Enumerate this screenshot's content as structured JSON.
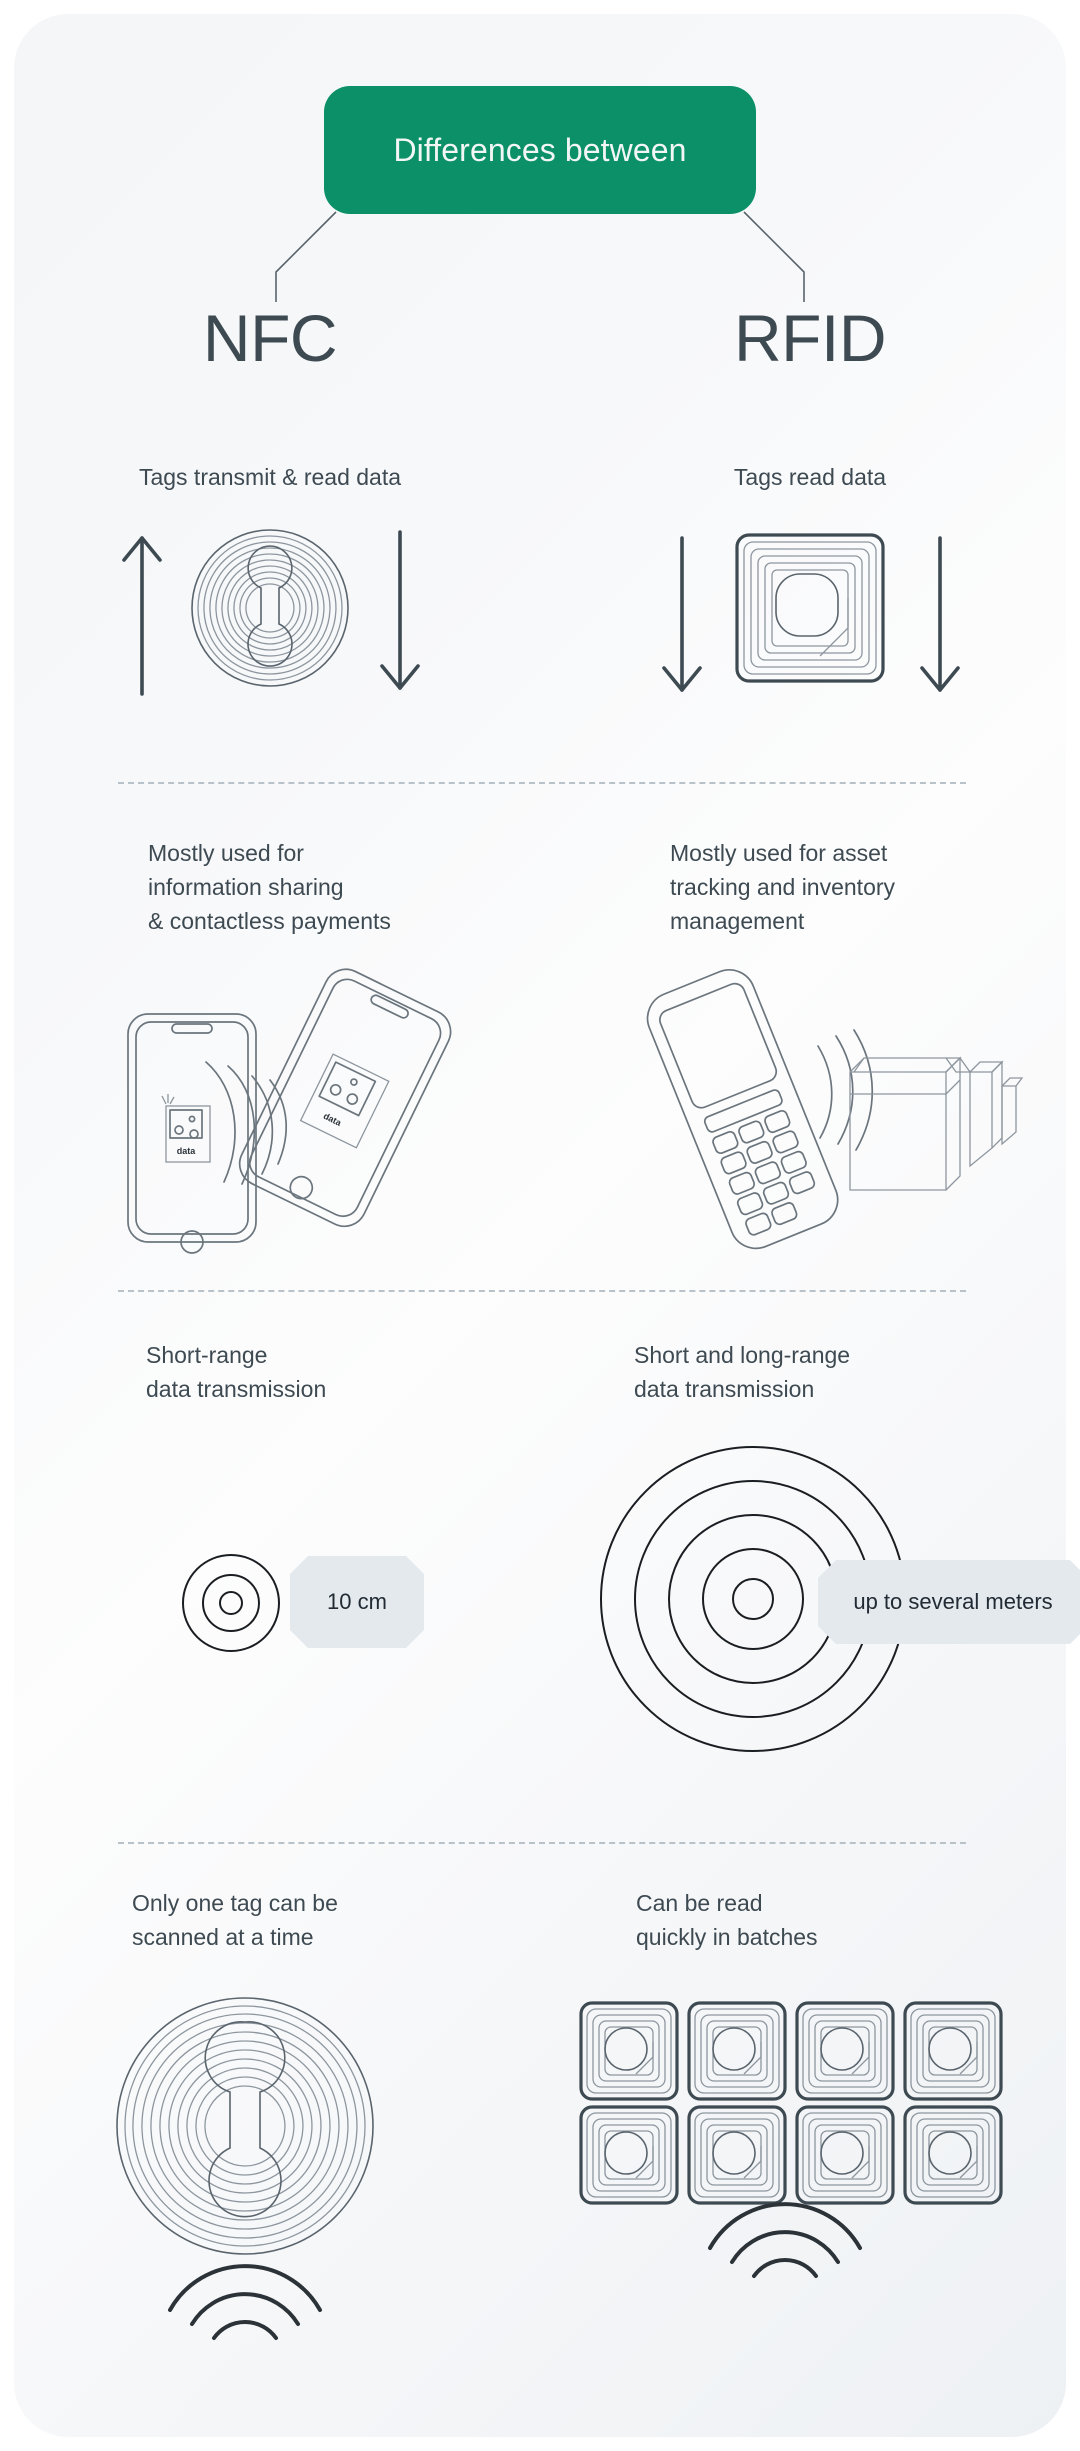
{
  "banner": {
    "title": "Differences between"
  },
  "columns": {
    "left": "NFC",
    "right": "RFID"
  },
  "colors": {
    "banner_green": "#0b9068",
    "text_dark": "#3e4a52",
    "pill_bg": "#e4e9ee",
    "panel_bg": "#f6f7f9",
    "line_gray": "#5a646d",
    "divider": "#b9c2c9"
  },
  "rows": [
    {
      "id": "row-transmit",
      "left": {
        "caption": "Tags transmit & read data",
        "art": "nfc-round-tag-with-two-arrows"
      },
      "right": {
        "caption": "Tags read data",
        "art": "rfid-square-tag-with-two-down-arrows"
      }
    },
    {
      "id": "row-usage",
      "left": {
        "caption": "Mostly used for\ninformation sharing\n& contactless payments",
        "art": "two-phones-exchanging-data",
        "art_labels": [
          "data",
          "data"
        ]
      },
      "right": {
        "caption": "Mostly used for asset\ntracking and inventory\nmanagement",
        "art": "handheld-scanner-and-boxes"
      }
    },
    {
      "id": "row-range",
      "left": {
        "caption": "Short-range\ndata transmission",
        "art": "small-concentric-circles",
        "badge": "10 cm"
      },
      "right": {
        "caption": "Short and long-range\ndata transmission",
        "art": "large-concentric-circles",
        "badge": "up to several meters"
      }
    },
    {
      "id": "row-batch",
      "left": {
        "caption": "Only one tag can be\nscanned at a time",
        "art": "single-round-nfc-tag-with-waves"
      },
      "right": {
        "caption": "Can be read\nquickly in batches",
        "art": "grid-of-eight-rfid-tags-with-waves",
        "tag_count": 8
      }
    }
  ],
  "icons": {
    "arrow_up": "arrow-up-icon",
    "arrow_down": "arrow-down-icon",
    "wave": "signal-wave-icon",
    "phone": "smartphone-icon",
    "scanner": "handheld-scanner-icon",
    "box": "cardboard-box-icon"
  }
}
